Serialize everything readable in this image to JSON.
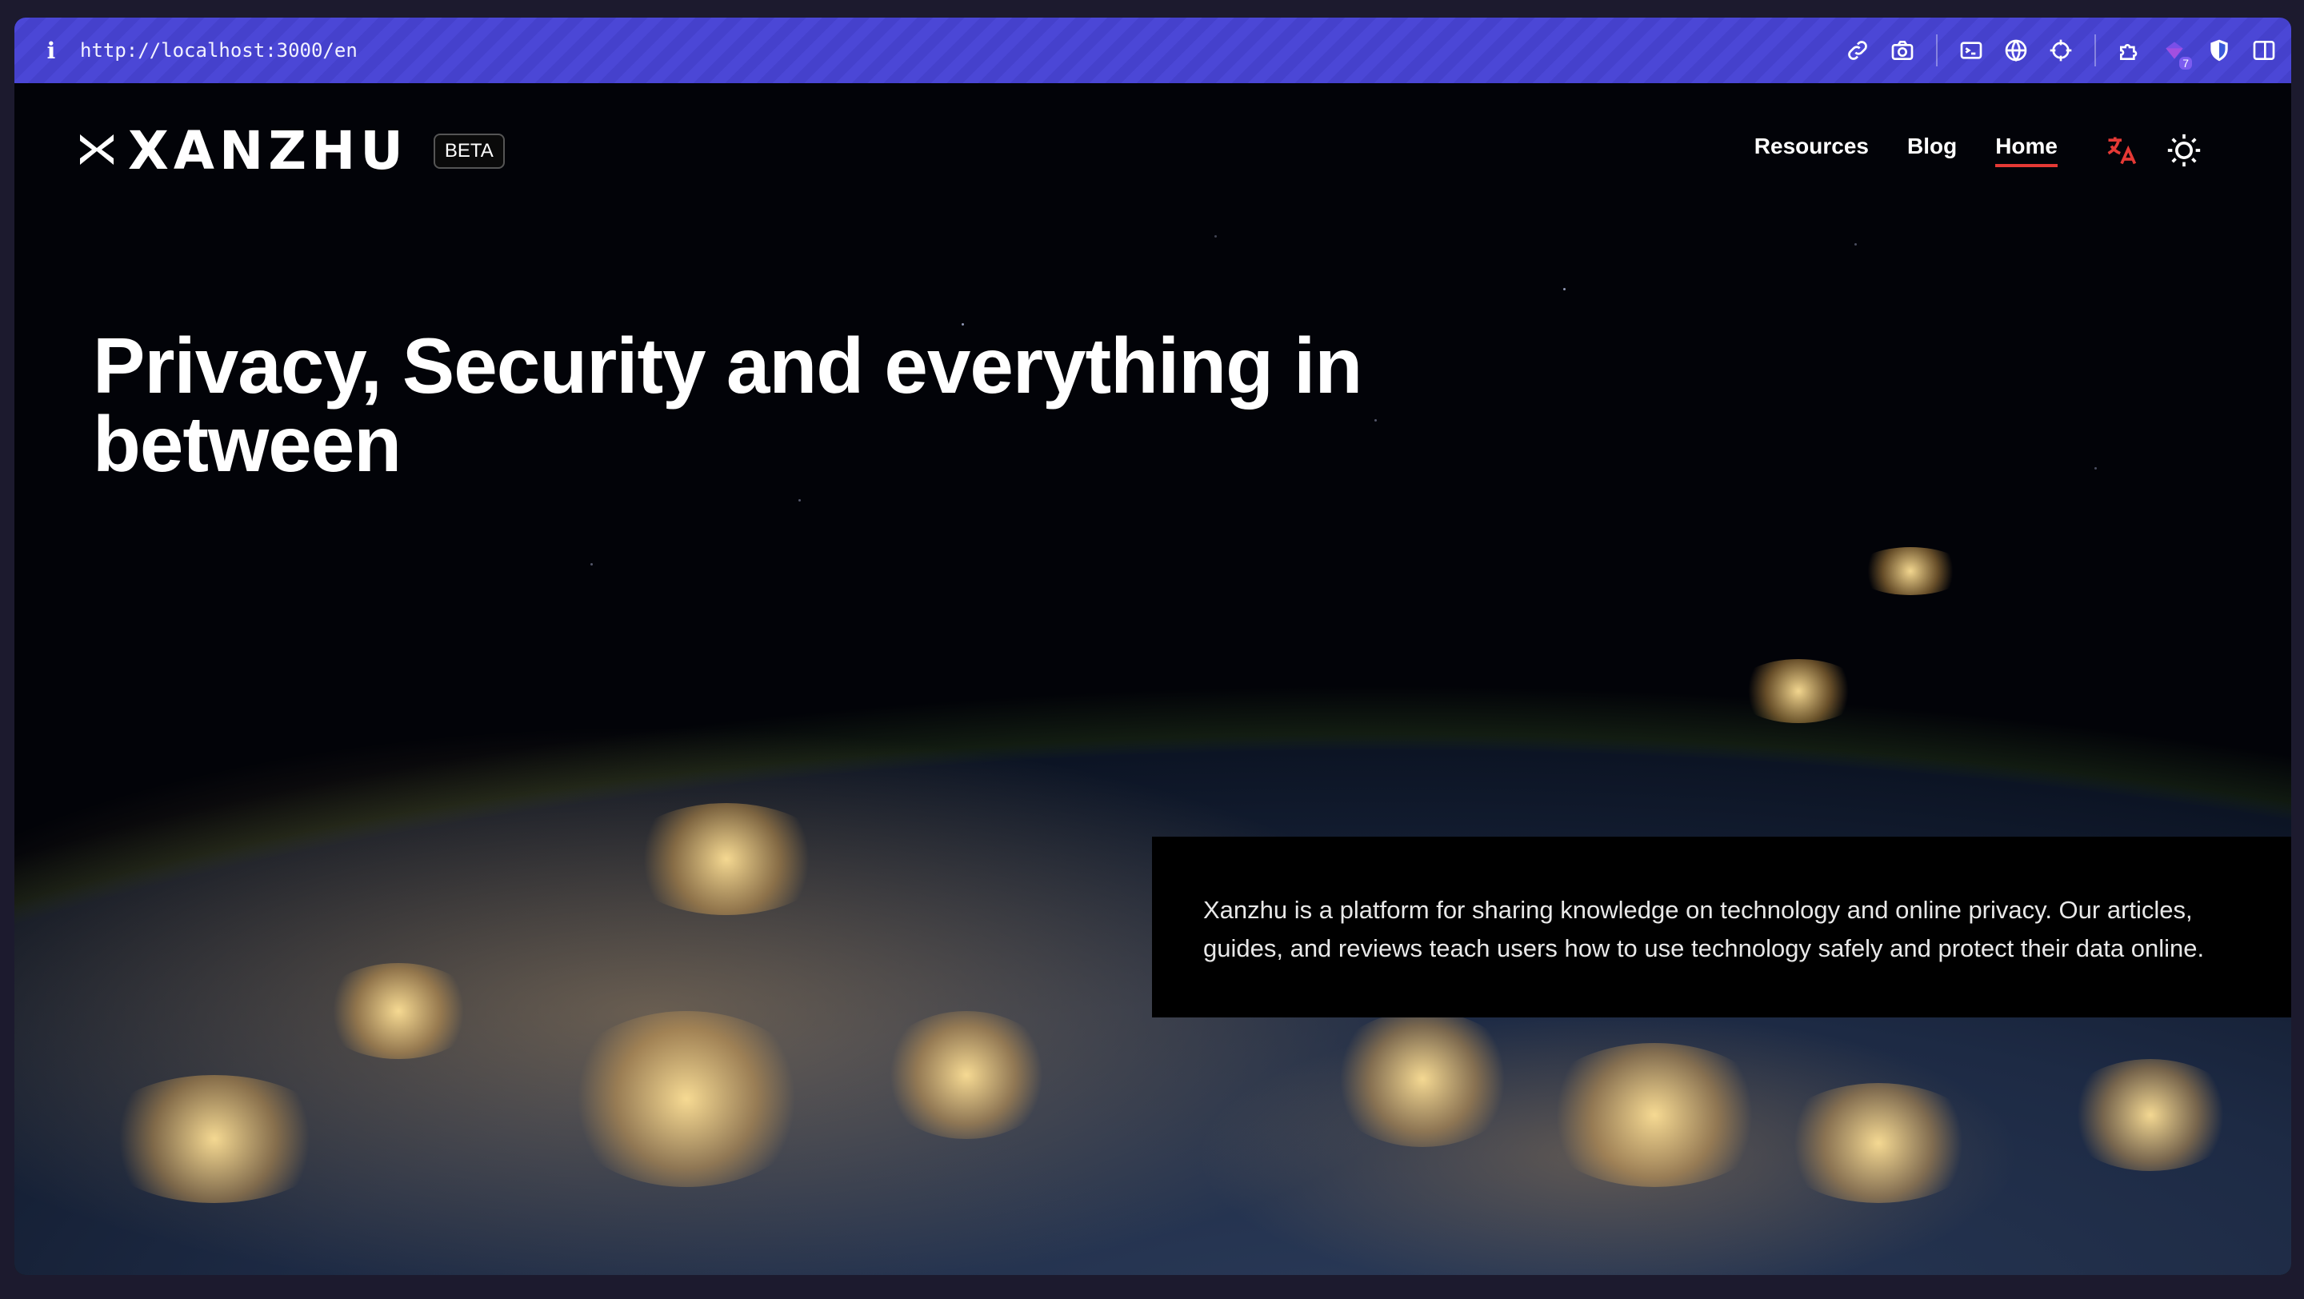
{
  "browser": {
    "info_icon": "i",
    "url": "http://localhost:3000/en",
    "extension_badge_count": "7",
    "icons": [
      "link-icon",
      "camera-icon",
      "terminal-icon",
      "globe-icon",
      "crosshair-icon",
      "puzzle-icon",
      "extension-gem-icon",
      "shield-icon",
      "sidebar-icon"
    ]
  },
  "site": {
    "brand": "XANZHU",
    "beta_label": "BETA",
    "nav": {
      "resources": "Resources",
      "blog": "Blog",
      "home": "Home"
    },
    "accent_color": "#e53935",
    "headline": "Privacy, Security and everything in between",
    "description": "Xanzhu is a platform for sharing knowledge on technology and online privacy. Our articles, guides, and reviews teach users how to use technology safely and protect their data online."
  }
}
